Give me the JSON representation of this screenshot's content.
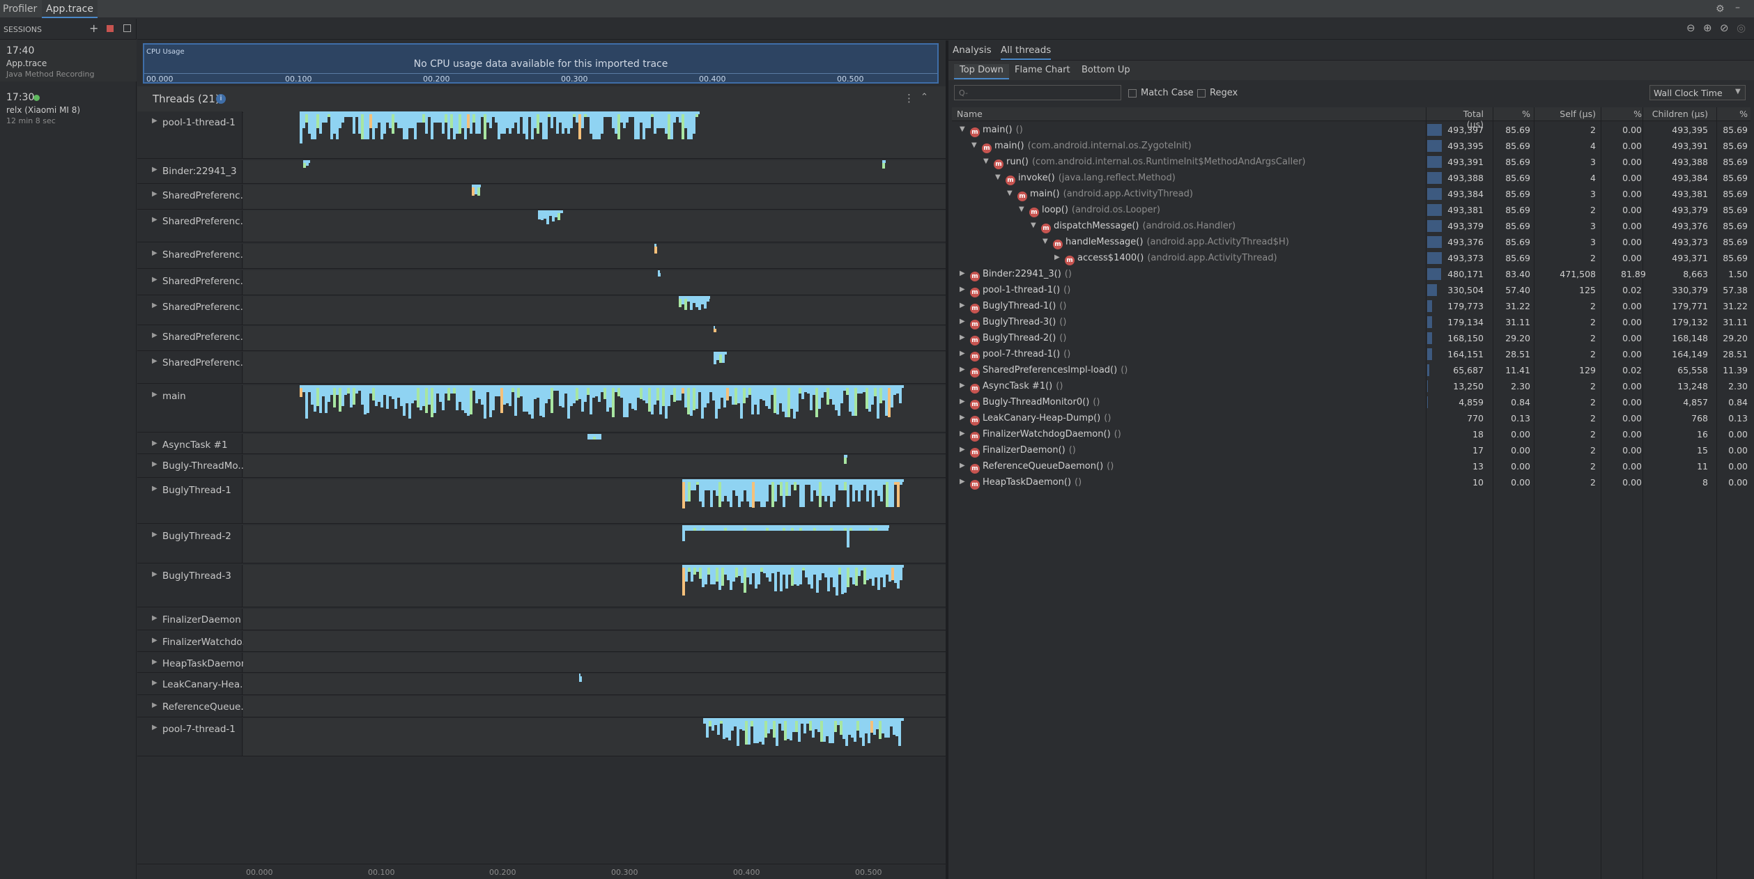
{
  "titlebar": {
    "tab_profiler": "Profiler",
    "tab_trace": "App.trace"
  },
  "sessions": {
    "header": "SESSIONS",
    "items": [
      {
        "time": "17:40",
        "name": "App.trace",
        "detail": "Java Method Recording"
      },
      {
        "time": "17:30",
        "name": "relx (Xiaomi MI 8)",
        "detail": "12 min 8 sec"
      }
    ]
  },
  "cpu": {
    "label": "CPU Usage",
    "message": "No CPU usage data available for this imported trace",
    "ticks": [
      "00.000",
      "00.100",
      "00.200",
      "00.300",
      "00.400",
      "00.500"
    ]
  },
  "threads": {
    "title": "Threads (21)",
    "rows": [
      {
        "label": "pool-1-thread-1"
      },
      {
        "label": "Binder:22941_3"
      },
      {
        "label": "SharedPreferenc..."
      },
      {
        "label": "SharedPreferenc..."
      },
      {
        "label": "SharedPreferenc..."
      },
      {
        "label": "SharedPreferenc..."
      },
      {
        "label": "SharedPreferenc..."
      },
      {
        "label": "SharedPreferenc..."
      },
      {
        "label": "SharedPreferenc..."
      },
      {
        "label": "main"
      },
      {
        "label": "AsyncTask #1"
      },
      {
        "label": "Bugly-ThreadMo..."
      },
      {
        "label": "BuglyThread-1"
      },
      {
        "label": "BuglyThread-2"
      },
      {
        "label": "BuglyThread-3"
      },
      {
        "label": "FinalizerDaemon"
      },
      {
        "label": "FinalizerWatchdo..."
      },
      {
        "label": "HeapTaskDaemon"
      },
      {
        "label": "LeakCanary-Hea..."
      },
      {
        "label": "ReferenceQueue..."
      },
      {
        "label": "pool-7-thread-1"
      }
    ],
    "axis_ticks": [
      "00.000",
      "00.100",
      "00.200",
      "00.300",
      "00.400",
      "00.500"
    ]
  },
  "analysis": {
    "tab_analysis": "Analysis",
    "tab_all_threads": "All threads",
    "subtabs": [
      "Top Down",
      "Flame Chart",
      "Bottom Up"
    ],
    "search_placeholder": "Q-",
    "match_case": "Match Case",
    "regex": "Regex",
    "clock_select": "Wall Clock Time",
    "columns": [
      "Name",
      "Total (μs)",
      "%",
      "Self (μs)",
      "%",
      "Children (μs)",
      "%"
    ],
    "rows": [
      {
        "depth": 0,
        "open": true,
        "name": "main()",
        "cls": "()",
        "total": "493,397",
        "tp": "85.69",
        "self": "2",
        "sp": "0.00",
        "child": "493,395",
        "cp": "85.69",
        "frac": 0.857
      },
      {
        "depth": 1,
        "open": true,
        "name": "main()",
        "cls": "(com.android.internal.os.ZygoteInit)",
        "total": "493,395",
        "tp": "85.69",
        "self": "4",
        "sp": "0.00",
        "child": "493,391",
        "cp": "85.69",
        "frac": 0.857
      },
      {
        "depth": 2,
        "open": true,
        "name": "run()",
        "cls": "(com.android.internal.os.RuntimeInit$MethodAndArgsCaller)",
        "total": "493,391",
        "tp": "85.69",
        "self": "3",
        "sp": "0.00",
        "child": "493,388",
        "cp": "85.69",
        "frac": 0.857
      },
      {
        "depth": 3,
        "open": true,
        "name": "invoke()",
        "cls": "(java.lang.reflect.Method)",
        "total": "493,388",
        "tp": "85.69",
        "self": "4",
        "sp": "0.00",
        "child": "493,384",
        "cp": "85.69",
        "frac": 0.857
      },
      {
        "depth": 4,
        "open": true,
        "name": "main()",
        "cls": "(android.app.ActivityThread)",
        "total": "493,384",
        "tp": "85.69",
        "self": "3",
        "sp": "0.00",
        "child": "493,381",
        "cp": "85.69",
        "frac": 0.857
      },
      {
        "depth": 5,
        "open": true,
        "name": "loop()",
        "cls": "(android.os.Looper)",
        "total": "493,381",
        "tp": "85.69",
        "self": "2",
        "sp": "0.00",
        "child": "493,379",
        "cp": "85.69",
        "frac": 0.857
      },
      {
        "depth": 6,
        "open": true,
        "name": "dispatchMessage()",
        "cls": "(android.os.Handler)",
        "total": "493,379",
        "tp": "85.69",
        "self": "3",
        "sp": "0.00",
        "child": "493,376",
        "cp": "85.69",
        "frac": 0.857
      },
      {
        "depth": 7,
        "open": true,
        "name": "handleMessage()",
        "cls": "(android.app.ActivityThread$H)",
        "total": "493,376",
        "tp": "85.69",
        "self": "3",
        "sp": "0.00",
        "child": "493,373",
        "cp": "85.69",
        "frac": 0.857
      },
      {
        "depth": 8,
        "open": false,
        "name": "access$1400()",
        "cls": "(android.app.ActivityThread)",
        "total": "493,373",
        "tp": "85.69",
        "self": "2",
        "sp": "0.00",
        "child": "493,371",
        "cp": "85.69",
        "frac": 0.857
      },
      {
        "depth": 0,
        "open": false,
        "name": "Binder:22941_3()",
        "cls": "()",
        "total": "480,171",
        "tp": "83.40",
        "self": "471,508",
        "sp": "81.89",
        "child": "8,663",
        "cp": "1.50",
        "frac": 0.834
      },
      {
        "depth": 0,
        "open": false,
        "name": "pool-1-thread-1()",
        "cls": "()",
        "total": "330,504",
        "tp": "57.40",
        "self": "125",
        "sp": "0.02",
        "child": "330,379",
        "cp": "57.38",
        "frac": 0.574
      },
      {
        "depth": 0,
        "open": false,
        "name": "BuglyThread-1()",
        "cls": "()",
        "total": "179,773",
        "tp": "31.22",
        "self": "2",
        "sp": "0.00",
        "child": "179,771",
        "cp": "31.22",
        "frac": 0.312
      },
      {
        "depth": 0,
        "open": false,
        "name": "BuglyThread-3()",
        "cls": "()",
        "total": "179,134",
        "tp": "31.11",
        "self": "2",
        "sp": "0.00",
        "child": "179,132",
        "cp": "31.11",
        "frac": 0.311
      },
      {
        "depth": 0,
        "open": false,
        "name": "BuglyThread-2()",
        "cls": "()",
        "total": "168,150",
        "tp": "29.20",
        "self": "2",
        "sp": "0.00",
        "child": "168,148",
        "cp": "29.20",
        "frac": 0.292
      },
      {
        "depth": 0,
        "open": false,
        "name": "pool-7-thread-1()",
        "cls": "()",
        "total": "164,151",
        "tp": "28.51",
        "self": "2",
        "sp": "0.00",
        "child": "164,149",
        "cp": "28.51",
        "frac": 0.285
      },
      {
        "depth": 0,
        "open": false,
        "name": "SharedPreferencesImpl-load()",
        "cls": "()",
        "total": "65,687",
        "tp": "11.41",
        "self": "129",
        "sp": "0.02",
        "child": "65,558",
        "cp": "11.39",
        "frac": 0.114
      },
      {
        "depth": 0,
        "open": false,
        "name": "AsyncTask #1()",
        "cls": "()",
        "total": "13,250",
        "tp": "2.30",
        "self": "2",
        "sp": "0.00",
        "child": "13,248",
        "cp": "2.30",
        "frac": 0.023
      },
      {
        "depth": 0,
        "open": false,
        "name": "Bugly-ThreadMonitor0()",
        "cls": "()",
        "total": "4,859",
        "tp": "0.84",
        "self": "2",
        "sp": "0.00",
        "child": "4,857",
        "cp": "0.84",
        "frac": 0.008
      },
      {
        "depth": 0,
        "open": false,
        "name": "LeakCanary-Heap-Dump()",
        "cls": "()",
        "total": "770",
        "tp": "0.13",
        "self": "2",
        "sp": "0.00",
        "child": "768",
        "cp": "0.13",
        "frac": 0.001
      },
      {
        "depth": 0,
        "open": false,
        "name": "FinalizerWatchdogDaemon()",
        "cls": "()",
        "total": "18",
        "tp": "0.00",
        "self": "2",
        "sp": "0.00",
        "child": "16",
        "cp": "0.00",
        "frac": 0
      },
      {
        "depth": 0,
        "open": false,
        "name": "FinalizerDaemon()",
        "cls": "()",
        "total": "17",
        "tp": "0.00",
        "self": "2",
        "sp": "0.00",
        "child": "15",
        "cp": "0.00",
        "frac": 0
      },
      {
        "depth": 0,
        "open": false,
        "name": "ReferenceQueueDaemon()",
        "cls": "()",
        "total": "13",
        "tp": "0.00",
        "self": "2",
        "sp": "0.00",
        "child": "11",
        "cp": "0.00",
        "frac": 0
      },
      {
        "depth": 0,
        "open": false,
        "name": "HeapTaskDaemon()",
        "cls": "()",
        "total": "10",
        "tp": "0.00",
        "self": "2",
        "sp": "0.00",
        "child": "8",
        "cp": "0.00",
        "frac": 0
      }
    ]
  },
  "colors": {
    "accent": "#4a88c7",
    "method_icon": "#c75450",
    "flame_blue": "#8fd3f2",
    "flame_orange": "#f5c07a",
    "flame_green": "#a8e6a1"
  }
}
